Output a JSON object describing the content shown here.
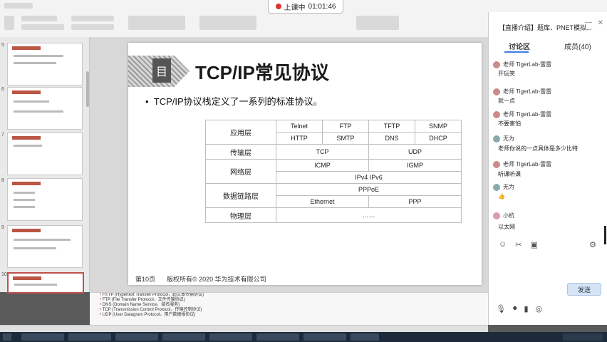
{
  "recording": {
    "label": "上课中",
    "time": "01:01:46"
  },
  "thumbnails": [
    {
      "num": "5",
      "title": "分层模型"
    },
    {
      "num": "6",
      "title": "分层模型"
    },
    {
      "num": "7",
      "title": "OSI"
    },
    {
      "num": "8",
      "title": "TCP/IP"
    },
    {
      "num": "9",
      "title": "TCP/IP"
    },
    {
      "num": "10",
      "title": "TCP/IP常见协议"
    }
  ],
  "slide": {
    "icon_glyph": "目",
    "title": "TCP/IP常见协议",
    "bullet": "TCP/IP协议栈定义了一系列的标准协议。",
    "layers": {
      "app": "应用层",
      "transport": "传输层",
      "network": "网络层",
      "datalink": "数据链路层",
      "physical": "物理层"
    },
    "protocols": {
      "telnet": "Telnet",
      "ftp": "FTP",
      "tftp": "TFTP",
      "snmp": "SNMP",
      "http": "HTTP",
      "smtp": "SMTP",
      "dns": "DNS",
      "dhcp": "DHCP",
      "tcp": "TCP",
      "udp": "UDP",
      "icmp": "ICMP",
      "igmp": "IGMP",
      "ipv": "IPv4 IPv6",
      "pppoe": "PPPoE",
      "ethernet": "Ethernet",
      "ppp": "PPP",
      "physical": "……"
    },
    "footer_page": "第10页",
    "footer_copy": "版权所有© 2020 华为技术有限公司"
  },
  "notes": [
    "HTTP (Hypertext Transfer Protocol，超文本传输协议)",
    "FTP (File Transfer Protocol，文件传输协议)",
    "DNS (Domain Name Service，域名服务)",
    "TCP (Transmission Control Protocol，传输控制协议)",
    "UDP (User Datagram Protocol，用户数据报协议)"
  ],
  "chat": {
    "header": "【直播介绍】题库、PNET模拟...",
    "tab_discussion": "讨论区",
    "tab_members": "成员(40)",
    "messages": [
      {
        "user": "老师 TigerLab-雷雷",
        "text": "开玩笑"
      },
      {
        "user": "老师 TigerLab-雷雷",
        "text": "就一点"
      },
      {
        "user": "老师 TigerLab-雷雷",
        "text": "不要害怕"
      },
      {
        "user": "无为",
        "text": "老师你说的一点具体是多少比特"
      },
      {
        "user": "老师 TigerLab-雷雷",
        "text": "听课听课"
      },
      {
        "user": "无为",
        "text": ""
      },
      {
        "user": "小杭",
        "text": "以太网"
      }
    ],
    "send": "发送"
  }
}
